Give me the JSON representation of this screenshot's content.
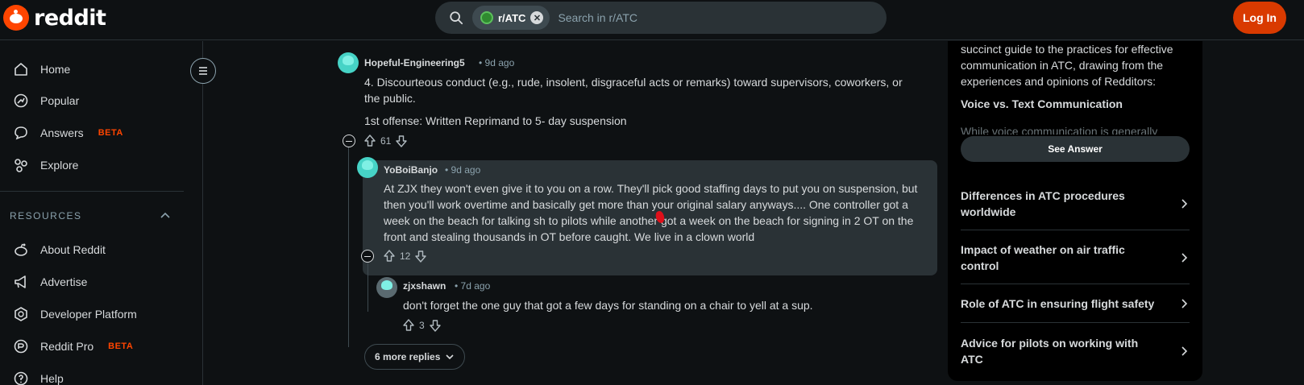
{
  "header": {
    "logo_text": "reddit",
    "search_chip": "r/ATC",
    "search_placeholder": "Search in r/ATC",
    "login_label": "Log In"
  },
  "sidebar": {
    "items": [
      {
        "label": "Home",
        "icon": "home-icon"
      },
      {
        "label": "Popular",
        "icon": "popular-icon"
      },
      {
        "label": "Answers",
        "icon": "answers-icon",
        "badge": "BETA"
      },
      {
        "label": "Explore",
        "icon": "explore-icon"
      }
    ],
    "resources_label": "RESOURCES",
    "resources": [
      {
        "label": "About Reddit",
        "icon": "reddit-alien-icon"
      },
      {
        "label": "Advertise",
        "icon": "megaphone-icon"
      },
      {
        "label": "Developer Platform",
        "icon": "developer-icon"
      },
      {
        "label": "Reddit Pro",
        "icon": "pro-icon",
        "badge": "BETA"
      },
      {
        "label": "Help",
        "icon": "help-icon"
      }
    ]
  },
  "comments": [
    {
      "author": "Hopeful-Engineering5",
      "time": "9d ago",
      "text1": "4. Discourteous conduct (e.g., rude, insolent, disgraceful acts or remarks) toward supervisors, coworkers, or the public.",
      "text2": "1st offense: Written Reprimand to 5- day suspension",
      "votes": "61"
    },
    {
      "author": "YoBoiBanjo",
      "time": "9d ago",
      "text": "At ZJX they won't even give it to you on a row. They'll pick good staffing days to put you on suspension, but then you'll work overtime and basically get more than your original salary anyways.... One controller got a week on the beach for talking sh to pilots while another got a week on the beach for signing in 2 OT on the front and stealing thousands in OT before caught. We live in a clown world",
      "votes": "12"
    },
    {
      "author": "zjxshawn",
      "time": "7d ago",
      "text": "don't forget the one guy that got a few days for standing on a chair to yell at a sup.",
      "votes": "3"
    }
  ],
  "more_replies": "6 more replies",
  "right_panel": {
    "intro": "succinct guide to the practices for effective communication in ATC, drawing from the experiences and opinions of Redditors:",
    "heading": "Voice vs. Text Communication",
    "fade_text": "While voice communication is generally",
    "see_answer": "See Answer",
    "related": [
      "Differences in ATC procedures worldwide",
      "Impact of weather on air traffic control",
      "Role of ATC in ensuring flight safety",
      "Advice for pilots on working with ATC"
    ]
  }
}
